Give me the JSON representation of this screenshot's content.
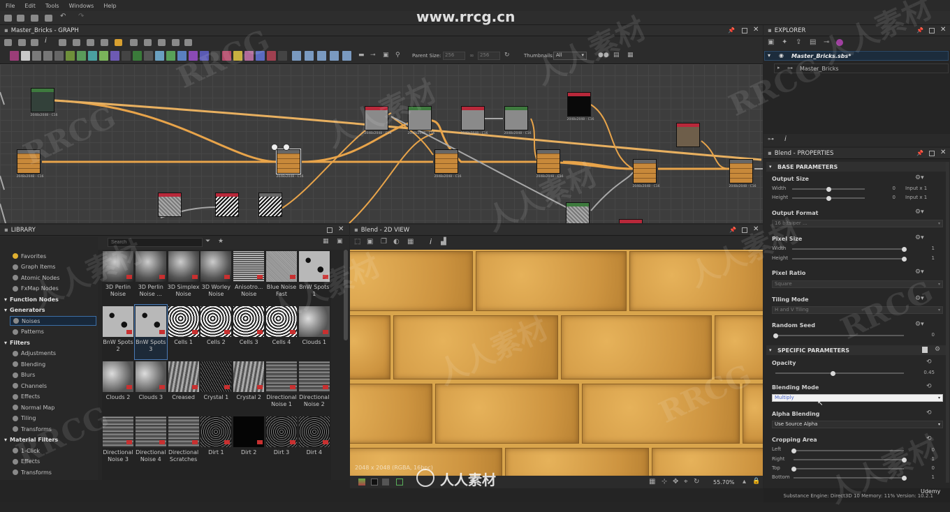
{
  "menu": [
    "File",
    "Edit",
    "Tools",
    "Windows",
    "Help"
  ],
  "graph": {
    "title": "Master_Bricks - GRAPH",
    "parent_size_label": "Parent Size:",
    "parent_size_value": "256",
    "parent_size_value2": "256",
    "thumbnails_label": "Thumbnails:",
    "thumbnails_value": "All",
    "node_label": "2048x2048 - C16"
  },
  "explorer": {
    "title": "EXPLORER",
    "file": "Master_Bricks.sbs*",
    "graph": "Master_Bricks"
  },
  "library": {
    "title": "LIBRARY",
    "search_placeholder": "Search",
    "tree": [
      {
        "label": "Favorites",
        "type": "item"
      },
      {
        "label": "Graph Items",
        "type": "item"
      },
      {
        "label": "Atomic Nodes",
        "type": "item"
      },
      {
        "label": "FxMap Nodes",
        "type": "item"
      },
      {
        "label": "Function Nodes",
        "type": "header"
      },
      {
        "label": "Generators",
        "type": "header"
      },
      {
        "label": "Noises",
        "type": "selected"
      },
      {
        "label": "Patterns",
        "type": "item"
      },
      {
        "label": "Filters",
        "type": "header"
      },
      {
        "label": "Adjustments",
        "type": "item"
      },
      {
        "label": "Blending",
        "type": "item"
      },
      {
        "label": "Blurs",
        "type": "item"
      },
      {
        "label": "Channels",
        "type": "item"
      },
      {
        "label": "Effects",
        "type": "item"
      },
      {
        "label": "Normal Map",
        "type": "item"
      },
      {
        "label": "Tiling",
        "type": "item"
      },
      {
        "label": "Transforms",
        "type": "item"
      },
      {
        "label": "Material Filters",
        "type": "header"
      },
      {
        "label": "1-Click",
        "type": "item"
      },
      {
        "label": "Effects",
        "type": "item"
      },
      {
        "label": "Transforms",
        "type": "item"
      }
    ],
    "thumbs": [
      {
        "label": "3D Perlin Noise",
        "tex": "cube"
      },
      {
        "label": "3D Perlin Noise ...",
        "tex": "cube"
      },
      {
        "label": "3D Simplex Noise",
        "tex": "cube"
      },
      {
        "label": "3D Worley Noise",
        "tex": "cube"
      },
      {
        "label": "Anisotro... Noise",
        "tex": "aniso"
      },
      {
        "label": "Blue Noise Fast",
        "tex": "blue"
      },
      {
        "label": "BnW Spots 1",
        "tex": "spots"
      },
      {
        "label": "BnW Spots 2",
        "tex": "spots"
      },
      {
        "label": "BnW Spots 3",
        "tex": "spots"
      },
      {
        "label": "Cells 1",
        "tex": "cells"
      },
      {
        "label": "Cells 2",
        "tex": "cells"
      },
      {
        "label": "Cells 3",
        "tex": "cells"
      },
      {
        "label": "Cells 4",
        "tex": "cells"
      },
      {
        "label": "Clouds 1",
        "tex": "clouds"
      },
      {
        "label": "Clouds 2",
        "tex": "clouds"
      },
      {
        "label": "Clouds 3",
        "tex": "clouds"
      },
      {
        "label": "Creased",
        "tex": "crease"
      },
      {
        "label": "Crystal 1",
        "tex": "crystal"
      },
      {
        "label": "Crystal 2",
        "tex": "crease"
      },
      {
        "label": "Directional Noise 1",
        "tex": "dir"
      },
      {
        "label": "Directional Noise 2",
        "tex": "dir"
      },
      {
        "label": "Directional Noise 3",
        "tex": "dir"
      },
      {
        "label": "Directional Noise 4",
        "tex": "dir"
      },
      {
        "label": "Directional Scratches",
        "tex": "dir"
      },
      {
        "label": "Dirt 1",
        "tex": "dirt"
      },
      {
        "label": "Dirt 2",
        "tex": "dark"
      },
      {
        "label": "Dirt 3",
        "tex": "dirt"
      },
      {
        "label": "Dirt 4",
        "tex": "dirt"
      }
    ]
  },
  "view2d": {
    "title": "Blend - 2D VIEW",
    "info": "2048 x 2048 (RGBA, 16bpc)",
    "zoom": "55.70%"
  },
  "props": {
    "title": "Blend - PROPERTIES",
    "base_section": "BASE PARAMETERS",
    "output_size": "Output Size",
    "width": "Width",
    "height": "Height",
    "size_w_val": "0",
    "size_h_val": "0",
    "size_w_mode": "Input x 1",
    "size_h_mode": "Input x 1",
    "output_format": "Output Format",
    "output_format_val": "16 bits per ...",
    "pixel_size": "Pixel Size",
    "px_w_val": "1",
    "px_h_val": "1",
    "pixel_ratio": "Pixel Ratio",
    "pixel_ratio_val": "Square",
    "tiling_mode": "Tiling Mode",
    "tiling_mode_val": "H and V Tiling",
    "random_seed": "Random Seed",
    "random_seed_val": "0",
    "specific_section": "SPECIFIC PARAMETERS",
    "opacity": "Opacity",
    "opacity_val": "0.45",
    "blending_mode": "Blending Mode",
    "blending_mode_val": "Multiply",
    "alpha_blending": "Alpha Blending",
    "alpha_blending_val": "Use Source Alpha",
    "cropping_area": "Cropping Area",
    "left": "Left",
    "right": "Right",
    "top": "Top",
    "bottom": "Bottom",
    "left_val": "0",
    "right_val": "1",
    "top_val": "0",
    "bottom_val": "1"
  },
  "status": {
    "text": "Substance Engine: Direct3D 10  Memory: 11%  Version: 10.2.1"
  },
  "watermarks": {
    "url": "www.rrcg.cn",
    "brand": "RRCG",
    "cn": "人人素材",
    "udemy": "Udemy"
  },
  "colors": {
    "wire": "#e8a44a",
    "wire_gray": "#9a9a9a",
    "selection": "#3b6ea5",
    "blend_mode_text": "#4a66c8"
  }
}
